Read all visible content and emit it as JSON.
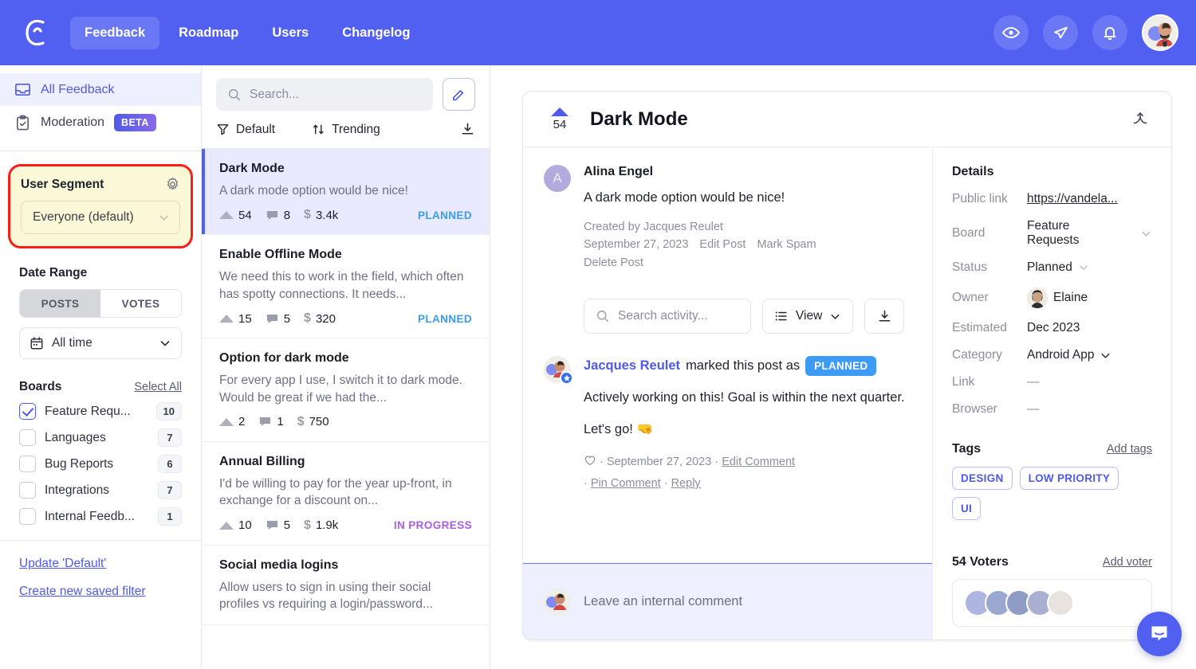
{
  "topnav": {
    "logo_icon": "crowd-logo-icon",
    "items": [
      {
        "label": "Feedback",
        "active": true
      },
      {
        "label": "Roadmap",
        "active": false
      },
      {
        "label": "Users",
        "active": false
      },
      {
        "label": "Changelog",
        "active": false
      }
    ],
    "right_icons": [
      "eye-icon",
      "megaphone-icon",
      "bell-icon"
    ],
    "avatar": "user-avatar"
  },
  "sidebar": {
    "nav": [
      {
        "label": "All Feedback",
        "icon": "inbox-icon",
        "selected": true,
        "badge": null
      },
      {
        "label": "Moderation",
        "icon": "clipboard-check-icon",
        "selected": false,
        "badge": "BETA"
      }
    ],
    "user_segment": {
      "title": "User Segment",
      "gear_icon": "gear-icon",
      "value": "Everyone (default)",
      "highlight_color": "#f71f18",
      "card_color": "#fbf8d8"
    },
    "date_range": {
      "title": "Date Range",
      "tabs": [
        {
          "label": "POSTS",
          "active": true
        },
        {
          "label": "VOTES",
          "active": false
        }
      ],
      "period": "All time",
      "calendar_icon": "calendar-icon"
    },
    "boards": {
      "title": "Boards",
      "select_all": "Select All",
      "items": [
        {
          "label": "Feature Requ...",
          "count": "10",
          "checked": true
        },
        {
          "label": "Languages",
          "count": "7",
          "checked": false
        },
        {
          "label": "Bug Reports",
          "count": "6",
          "checked": false
        },
        {
          "label": "Integrations",
          "count": "7",
          "checked": false
        },
        {
          "label": "Internal Feedb...",
          "count": "1",
          "checked": false
        }
      ]
    },
    "links": [
      {
        "label": "Update 'Default'"
      },
      {
        "label": "Create new saved filter"
      }
    ]
  },
  "postlist": {
    "search_placeholder": "Search...",
    "compose_icon": "pencil-icon",
    "filter_label": "Default",
    "filter_icon": "funnel-icon",
    "sort_label": "Trending",
    "sort_icon": "sort-arrows-icon",
    "download_icon": "download-icon",
    "posts": [
      {
        "title": "Dark Mode",
        "desc": "A dark mode option would be nice!",
        "votes": "54",
        "comments": "8",
        "value": "3.4k",
        "status": "PLANNED",
        "status_color": "#3b9bf5",
        "selected": true
      },
      {
        "title": "Enable Offline Mode",
        "desc": "We need this to work in the field, which often has spotty connections. It needs...",
        "votes": "15",
        "comments": "5",
        "value": "320",
        "status": "PLANNED",
        "status_color": "#3b9bf5",
        "selected": false
      },
      {
        "title": "Option for dark mode",
        "desc": "For every app I use, I switch it to dark mode. Would be great if we had the...",
        "votes": "2",
        "comments": "1",
        "value": "750",
        "status": "",
        "status_color": "",
        "selected": false
      },
      {
        "title": "Annual Billing",
        "desc": "I'd be willing to pay for the year up-front, in exchange for a discount on...",
        "votes": "10",
        "comments": "5",
        "value": "1.9k",
        "status": "IN PROGRESS",
        "status_color": "#a95ce8",
        "selected": false
      },
      {
        "title": "Social media logins",
        "desc": "Allow users to sign in using their social profiles vs requiring a login/password...",
        "votes": "",
        "comments": "",
        "value": "",
        "status": "",
        "status_color": "",
        "selected": false
      }
    ]
  },
  "detail": {
    "vote_count": "54",
    "title": "Dark Mode",
    "merge_icon": "merge-icon",
    "post": {
      "avatar_letter": "A",
      "author": "Alina Engel",
      "body": "A dark mode option would be nice!",
      "created_by": "Created by Jacques Reulet",
      "date": "September 27, 2023",
      "edit_label": "Edit Post",
      "spam_label": "Mark Spam",
      "delete_label": "Delete Post"
    },
    "activity_toolbar": {
      "search_placeholder": "Search activity...",
      "search_icon": "search-icon",
      "view_label": "View",
      "view_icon": "list-icon",
      "chevron_icon": "chevron-down-icon",
      "download_icon": "download-icon"
    },
    "comment": {
      "author": "Jacques Reulet",
      "action": "marked this post as",
      "status_badge": "PLANNED",
      "text_line1": "Actively working on this! Goal is within the next quarter.",
      "text_line2": "Let's go! 🤜",
      "heart_icon": "heart-icon",
      "date": "September 27, 2023",
      "edit_label": "Edit Comment",
      "pin_label": "Pin Comment",
      "reply_label": "Reply"
    },
    "internal_comment_placeholder": "Leave an internal comment"
  },
  "details_panel": {
    "title": "Details",
    "rows": [
      {
        "key": "Public link",
        "value": "https://vandela...",
        "type": "link"
      },
      {
        "key": "Board",
        "value": "Feature Requests",
        "type": "select"
      },
      {
        "key": "Status",
        "value": "Planned",
        "type": "select"
      },
      {
        "key": "Owner",
        "value": "Elaine",
        "type": "avatar"
      },
      {
        "key": "Estimated",
        "value": "Dec 2023",
        "type": "text"
      },
      {
        "key": "Category",
        "value": "Android App",
        "type": "select"
      },
      {
        "key": "Link",
        "value": "—",
        "type": "text"
      },
      {
        "key": "Browser",
        "value": "—",
        "type": "text"
      }
    ],
    "tags": {
      "title": "Tags",
      "add_label": "Add tags",
      "items": [
        "DESIGN",
        "LOW PRIORITY",
        "UI"
      ]
    },
    "voters": {
      "title": "54 Voters",
      "add_label": "Add voter"
    }
  },
  "intercom": {
    "icon": "chat-bubble-icon"
  }
}
